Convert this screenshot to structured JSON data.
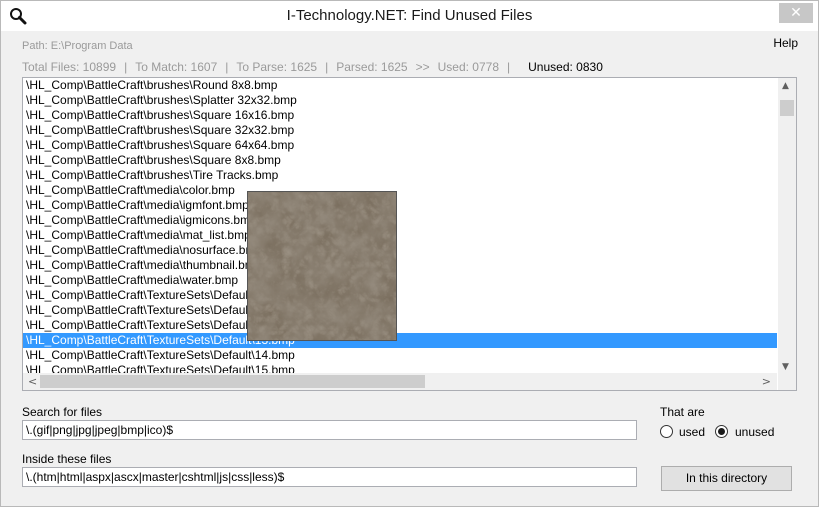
{
  "window": {
    "title": "I-Technology.NET: Find Unused Files",
    "close_glyph": "✕",
    "title_icon": "magnifier-icon"
  },
  "help_label": "Help",
  "path": "Path: E:\\Program Data",
  "stats": {
    "total": "Total Files: 10899",
    "to_match": "To Match: 1607",
    "to_parse": "To Parse: 1625",
    "parsed": "Parsed: 1625",
    "arrow": ">>",
    "used": "Used: 0778",
    "unused": "Unused: 0830",
    "separator": "|"
  },
  "file_list": {
    "items": [
      "\\HL_Comp\\BattleCraft\\brushes\\Round 8x8.bmp",
      "\\HL_Comp\\BattleCraft\\brushes\\Splatter 32x32.bmp",
      "\\HL_Comp\\BattleCraft\\brushes\\Square 16x16.bmp",
      "\\HL_Comp\\BattleCraft\\brushes\\Square 32x32.bmp",
      "\\HL_Comp\\BattleCraft\\brushes\\Square 64x64.bmp",
      "\\HL_Comp\\BattleCraft\\brushes\\Square 8x8.bmp",
      "\\HL_Comp\\BattleCraft\\brushes\\Tire Tracks.bmp",
      "\\HL_Comp\\BattleCraft\\media\\color.bmp",
      "\\HL_Comp\\BattleCraft\\media\\igmfont.bmp",
      "\\HL_Comp\\BattleCraft\\media\\igmicons.bmp",
      "\\HL_Comp\\BattleCraft\\media\\mat_list.bmp",
      "\\HL_Comp\\BattleCraft\\media\\nosurface.bmp",
      "\\HL_Comp\\BattleCraft\\media\\thumbnail.bmp",
      "\\HL_Comp\\BattleCraft\\media\\water.bmp",
      "\\HL_Comp\\BattleCraft\\TextureSets\\Default\\1.bmp",
      "\\HL_Comp\\BattleCraft\\TextureSets\\Default\\11.bmp",
      "\\HL_Comp\\BattleCraft\\TextureSets\\Default\\12.bmp",
      "\\HL_Comp\\BattleCraft\\TextureSets\\Default\\13.bmp",
      "\\HL_Comp\\BattleCraft\\TextureSets\\Default\\14.bmp",
      "\\HL_Comp\\BattleCraft\\TextureSets\\Default\\15.bmp"
    ],
    "selected_index": 17,
    "scroll_up": "▲",
    "scroll_down": "▼",
    "scroll_left": "<",
    "scroll_right": ">"
  },
  "search": {
    "label": "Search for files",
    "value": "\\.(gif|png|jpg|jpeg|bmp|ico)$"
  },
  "inside": {
    "label": "Inside these files",
    "value": "\\.(htm|html|aspx|ascx|master|cshtml|js|css|less)$"
  },
  "that_are": {
    "label": "That are",
    "used_label": "used",
    "unused_label": "unused",
    "selected": "unused"
  },
  "directory_button": "In this directory",
  "colors": {
    "selection": "#3399ff",
    "preview_base": "#7a6e5e"
  }
}
